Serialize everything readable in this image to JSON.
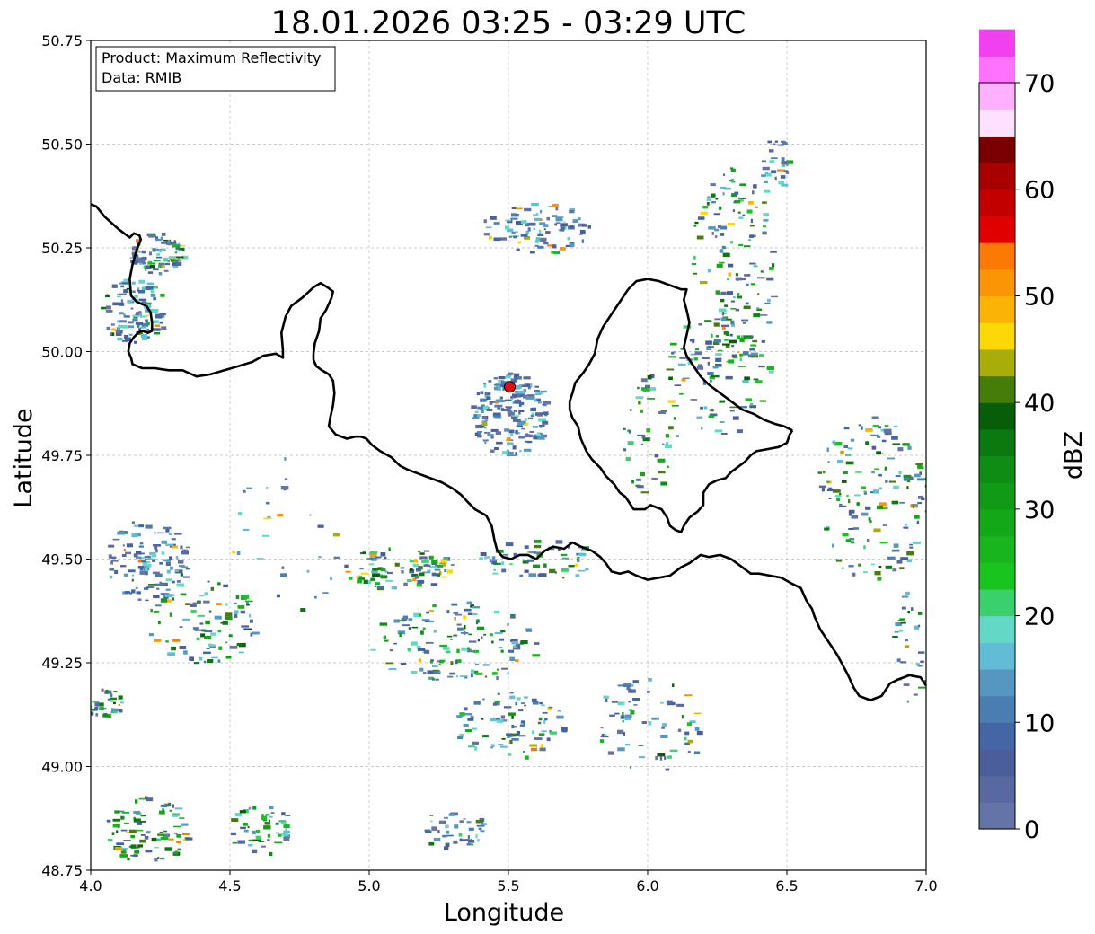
{
  "title": "18.01.2026 03:25 - 03:29 UTC",
  "info_box": {
    "product": "Product: Maximum Reflectivity",
    "data": "Data: RMIB"
  },
  "axes": {
    "xlabel": "Longitude",
    "ylabel": "Latitude",
    "xlim": [
      4.0,
      7.0
    ],
    "ylim": [
      48.75,
      50.75
    ],
    "xticks": [
      "4.0",
      "4.5",
      "5.0",
      "5.5",
      "6.0",
      "6.5",
      "7.0"
    ],
    "yticks": [
      "48.75",
      "49.00",
      "49.25",
      "49.50",
      "49.75",
      "50.00",
      "50.25",
      "50.50",
      "50.75"
    ],
    "grid": true
  },
  "radar_site": {
    "lon": 5.505,
    "lat": 49.915,
    "color": "#e01010"
  },
  "colorbar": {
    "label": "dBZ",
    "ticks": [
      "0",
      "10",
      "20",
      "30",
      "40",
      "50",
      "60",
      "70"
    ],
    "range": [
      0,
      70
    ],
    "step": 2.5,
    "colors": [
      "#6574a6",
      "#5868a0",
      "#4a5e9c",
      "#4466a6",
      "#4a7db2",
      "#5597c0",
      "#62bcd6",
      "#63d8c6",
      "#3ad06c",
      "#1ac41e",
      "#18b51e",
      "#13a818",
      "#119a15",
      "#0e8c14",
      "#0a7a10",
      "#065f08",
      "#457c0a",
      "#a8ad0a",
      "#fbd806",
      "#fbb306",
      "#fb9506",
      "#fb7a06",
      "#e00000",
      "#c20000",
      "#a80000",
      "#7a0000",
      "#ffe0ff",
      "#ffb1ff",
      "#ff72ff",
      "#f040f0"
    ]
  },
  "borders": {
    "west_border": [
      [
        4.0,
        50.355
      ],
      [
        4.02,
        50.35
      ],
      [
        4.05,
        50.325
      ],
      [
        4.1,
        50.295
      ],
      [
        4.12,
        50.285
      ],
      [
        4.14,
        50.275
      ],
      [
        4.155,
        50.285
      ],
      [
        4.175,
        50.28
      ],
      [
        4.18,
        50.27
      ],
      [
        4.165,
        50.245
      ],
      [
        4.15,
        50.21
      ],
      [
        4.14,
        50.175
      ],
      [
        4.145,
        50.135
      ],
      [
        4.165,
        50.12
      ],
      [
        4.2,
        50.11
      ],
      [
        4.215,
        50.095
      ],
      [
        4.22,
        50.07
      ],
      [
        4.22,
        50.05
      ],
      [
        4.205,
        50.045
      ],
      [
        4.185,
        50.05
      ],
      [
        4.17,
        50.045
      ],
      [
        4.155,
        50.035
      ],
      [
        4.14,
        50.02
      ],
      [
        4.135,
        50.0
      ],
      [
        4.145,
        49.985
      ],
      [
        4.15,
        49.97
      ],
      [
        4.185,
        49.96
      ],
      [
        4.23,
        49.96
      ],
      [
        4.28,
        49.955
      ],
      [
        4.33,
        49.955
      ],
      [
        4.38,
        49.94
      ],
      [
        4.43,
        49.945
      ],
      [
        4.48,
        49.955
      ],
      [
        4.53,
        49.965
      ],
      [
        4.58,
        49.975
      ],
      [
        4.62,
        49.99
      ],
      [
        4.665,
        49.995
      ],
      [
        4.69,
        49.985
      ],
      [
        4.69,
        50.005
      ],
      [
        4.685,
        50.045
      ],
      [
        4.7,
        50.085
      ],
      [
        4.72,
        50.11
      ],
      [
        4.76,
        50.13
      ],
      [
        4.8,
        50.155
      ],
      [
        4.825,
        50.165
      ],
      [
        4.85,
        50.155
      ],
      [
        4.87,
        50.145
      ],
      [
        4.865,
        50.13
      ],
      [
        4.845,
        50.1
      ],
      [
        4.825,
        50.08
      ],
      [
        4.82,
        50.05
      ],
      [
        4.805,
        50.02
      ],
      [
        4.8,
        49.995
      ],
      [
        4.8,
        49.98
      ],
      [
        4.81,
        49.965
      ],
      [
        4.83,
        49.955
      ],
      [
        4.855,
        49.945
      ],
      [
        4.87,
        49.93
      ],
      [
        4.875,
        49.9
      ],
      [
        4.87,
        49.87
      ],
      [
        4.86,
        49.84
      ],
      [
        4.855,
        49.82
      ],
      [
        4.88,
        49.8
      ],
      [
        4.92,
        49.79
      ],
      [
        4.95,
        49.795
      ],
      [
        4.97,
        49.795
      ],
      [
        4.99,
        49.79
      ],
      [
        5.01,
        49.775
      ],
      [
        5.04,
        49.76
      ],
      [
        5.08,
        49.745
      ],
      [
        5.11,
        49.725
      ],
      [
        5.14,
        49.715
      ],
      [
        5.18,
        49.705
      ],
      [
        5.22,
        49.695
      ],
      [
        5.26,
        49.685
      ],
      [
        5.3,
        49.67
      ],
      [
        5.33,
        49.655
      ],
      [
        5.35,
        49.64
      ],
      [
        5.38,
        49.62
      ],
      [
        5.42,
        49.605
      ],
      [
        5.44,
        49.58
      ],
      [
        5.45,
        49.545
      ],
      [
        5.46,
        49.52
      ],
      [
        5.48,
        49.505
      ],
      [
        5.51,
        49.5
      ],
      [
        5.54,
        49.51
      ],
      [
        5.57,
        49.51
      ],
      [
        5.6,
        49.5
      ]
    ],
    "east_border": [
      [
        5.6,
        49.5
      ],
      [
        5.63,
        49.52
      ],
      [
        5.66,
        49.53
      ],
      [
        5.7,
        49.525
      ],
      [
        5.73,
        49.54
      ],
      [
        5.76,
        49.53
      ],
      [
        5.8,
        49.52
      ],
      [
        5.83,
        49.505
      ],
      [
        5.85,
        49.49
      ],
      [
        5.87,
        49.47
      ],
      [
        5.9,
        49.465
      ],
      [
        5.93,
        49.47
      ],
      [
        5.96,
        49.46
      ],
      [
        6.0,
        49.45
      ],
      [
        6.04,
        49.455
      ],
      [
        6.08,
        49.46
      ],
      [
        6.12,
        49.48
      ],
      [
        6.15,
        49.49
      ],
      [
        6.19,
        49.51
      ],
      [
        6.22,
        49.505
      ],
      [
        6.26,
        49.51
      ],
      [
        6.3,
        49.5
      ],
      [
        6.34,
        49.48
      ],
      [
        6.37,
        49.465
      ],
      [
        6.4,
        49.465
      ],
      [
        6.44,
        49.46
      ],
      [
        6.48,
        49.455
      ],
      [
        6.52,
        49.44
      ],
      [
        6.55,
        49.43
      ],
      [
        6.57,
        49.4
      ],
      [
        6.59,
        49.38
      ],
      [
        6.6,
        49.36
      ],
      [
        6.62,
        49.33
      ],
      [
        6.65,
        49.3
      ],
      [
        6.68,
        49.27
      ],
      [
        6.7,
        49.245
      ],
      [
        6.72,
        49.22
      ],
      [
        6.74,
        49.19
      ],
      [
        6.76,
        49.17
      ],
      [
        6.8,
        49.16
      ],
      [
        6.84,
        49.17
      ],
      [
        6.87,
        49.2
      ],
      [
        6.9,
        49.21
      ],
      [
        6.94,
        49.22
      ],
      [
        6.98,
        49.215
      ],
      [
        7.0,
        49.195
      ]
    ],
    "north_border": [
      [
        6.52,
        49.81
      ],
      [
        6.51,
        49.8
      ],
      [
        6.5,
        49.78
      ],
      [
        6.47,
        49.77
      ],
      [
        6.43,
        49.765
      ],
      [
        6.39,
        49.76
      ],
      [
        6.37,
        49.75
      ],
      [
        6.35,
        49.735
      ],
      [
        6.32,
        49.72
      ],
      [
        6.3,
        49.71
      ],
      [
        6.28,
        49.695
      ],
      [
        6.25,
        49.69
      ],
      [
        6.22,
        49.68
      ],
      [
        6.2,
        49.66
      ],
      [
        6.2,
        49.63
      ],
      [
        6.18,
        49.615
      ],
      [
        6.15,
        49.6
      ],
      [
        6.13,
        49.58
      ],
      [
        6.12,
        49.565
      ],
      [
        6.1,
        49.57
      ],
      [
        6.08,
        49.58
      ],
      [
        6.07,
        49.6
      ],
      [
        6.05,
        49.62
      ],
      [
        6.01,
        49.63
      ],
      [
        5.99,
        49.62
      ],
      [
        5.95,
        49.62
      ],
      [
        5.92,
        49.65
      ],
      [
        5.9,
        49.66
      ],
      [
        5.88,
        49.68
      ],
      [
        5.85,
        49.7
      ],
      [
        5.83,
        49.72
      ],
      [
        5.8,
        49.74
      ],
      [
        5.78,
        49.76
      ],
      [
        5.76,
        49.79
      ],
      [
        5.75,
        49.82
      ],
      [
        5.73,
        49.84
      ],
      [
        5.72,
        49.86
      ],
      [
        5.72,
        49.88
      ],
      [
        5.73,
        49.9
      ],
      [
        5.74,
        49.925
      ],
      [
        5.77,
        49.95
      ],
      [
        5.79,
        49.97
      ],
      [
        5.81,
        49.995
      ],
      [
        5.82,
        50.03
      ],
      [
        5.84,
        50.06
      ],
      [
        5.87,
        50.09
      ],
      [
        5.9,
        50.12
      ],
      [
        5.93,
        50.15
      ],
      [
        5.96,
        50.17
      ],
      [
        6.0,
        50.175
      ],
      [
        6.04,
        50.17
      ],
      [
        6.08,
        50.16
      ],
      [
        6.12,
        50.15
      ],
      [
        6.14,
        50.15
      ],
      [
        6.13,
        50.125
      ],
      [
        6.14,
        50.1
      ],
      [
        6.15,
        50.07
      ],
      [
        6.14,
        50.04
      ],
      [
        6.13,
        50.01
      ],
      [
        6.14,
        49.99
      ],
      [
        6.16,
        49.97
      ],
      [
        6.19,
        49.94
      ],
      [
        6.22,
        49.92
      ],
      [
        6.26,
        49.9
      ],
      [
        6.3,
        49.88
      ],
      [
        6.34,
        49.86
      ],
      [
        6.38,
        49.85
      ],
      [
        6.42,
        49.835
      ],
      [
        6.46,
        49.825
      ],
      [
        6.49,
        49.82
      ],
      [
        6.52,
        49.81
      ]
    ]
  }
}
